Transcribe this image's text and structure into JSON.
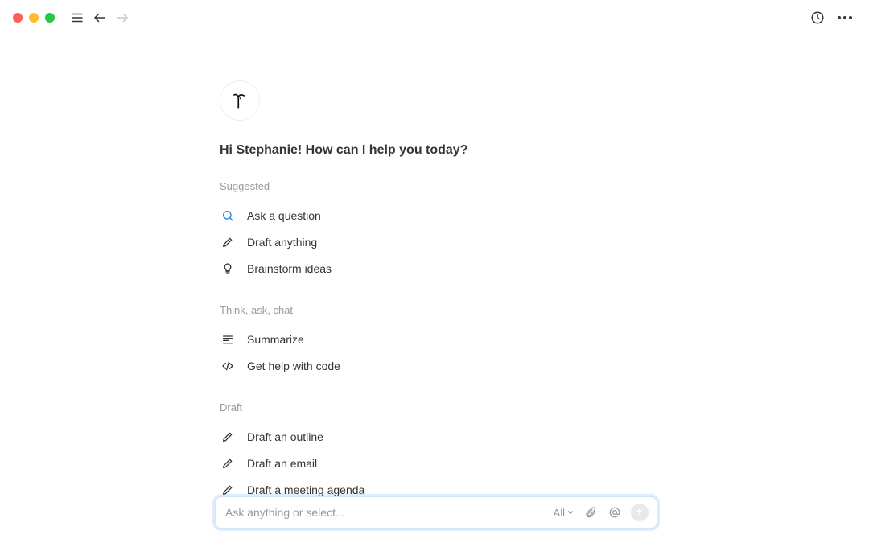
{
  "greeting": "Hi Stephanie! How can I help you today?",
  "sections": [
    {
      "label": "Suggested",
      "items": [
        {
          "icon": "search",
          "label": "Ask a question"
        },
        {
          "icon": "pencil",
          "label": "Draft anything"
        },
        {
          "icon": "bulb",
          "label": "Brainstorm ideas"
        }
      ]
    },
    {
      "label": "Think, ask, chat",
      "items": [
        {
          "icon": "summarize",
          "label": "Summarize"
        },
        {
          "icon": "code",
          "label": "Get help with code"
        }
      ]
    },
    {
      "label": "Draft",
      "items": [
        {
          "icon": "pencil",
          "label": "Draft an outline"
        },
        {
          "icon": "pencil",
          "label": "Draft an email"
        },
        {
          "icon": "pencil",
          "label": "Draft a meeting agenda"
        }
      ]
    }
  ],
  "input": {
    "placeholder": "Ask anything or select...",
    "scope_label": "All"
  }
}
